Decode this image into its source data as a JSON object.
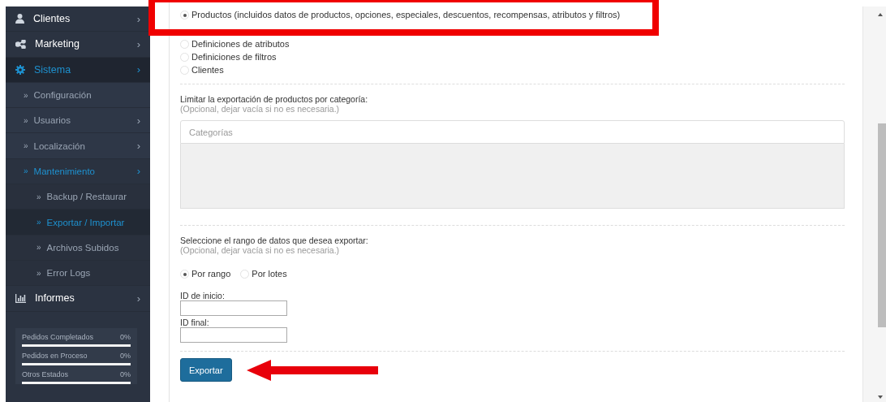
{
  "sidebar": {
    "items": [
      {
        "label": "Clientes",
        "selected": false,
        "arrow": "›"
      },
      {
        "label": "Marketing",
        "selected": false,
        "arrow": "›"
      },
      {
        "label": "Sistema",
        "selected": true,
        "arrow": "›",
        "children": [
          {
            "bullet": "»",
            "label": "Configuración",
            "selected": false
          },
          {
            "bullet": "»",
            "label": "Usuarios",
            "selected": false,
            "arrow": "›"
          },
          {
            "bullet": "»",
            "label": "Localización",
            "selected": false,
            "arrow": "›"
          },
          {
            "bullet": "»",
            "label": "Mantenimiento",
            "selected": true,
            "arrow": "›",
            "children": [
              {
                "bullet": "»",
                "label": "Backup / Restaurar",
                "selected": false
              },
              {
                "bullet": "»",
                "label": "Exportar / Importar",
                "selected": true
              },
              {
                "bullet": "»",
                "label": "Archivos Subidos",
                "selected": false
              },
              {
                "bullet": "»",
                "label": "Error Logs",
                "selected": false
              }
            ]
          }
        ]
      },
      {
        "label": "Informes",
        "selected": false,
        "arrow": "›"
      }
    ],
    "stats": [
      {
        "label": "Pedidos Completados",
        "reading": "0%",
        "level": 0
      },
      {
        "label": "Pedidos en Proceso",
        "reading": "0%",
        "level": 0
      },
      {
        "label": "Otros Estados",
        "reading": "0%",
        "level": 0
      }
    ]
  },
  "export_types": [
    {
      "label": "Productos (incluidos datos de productos, opciones, especiales, descuentos, recompensas, atributos y filtros)",
      "selected": true
    },
    {
      "label": "Definiciones de atributos",
      "selected": false
    },
    {
      "label": "Definiciones de filtros",
      "selected": false
    },
    {
      "label": "Clientes",
      "selected": false
    }
  ],
  "category_section": {
    "label": "Limitar la exportación de productos por categoría:",
    "hint": "(Opcional, dejar vacía si no es necesaria.)",
    "placeholder": "Categorías"
  },
  "range_section": {
    "label": "Seleccione el rango de datos que desea exportar:",
    "hint": "(Opcional, dejar vacía si no es necesaria.)",
    "modes": [
      {
        "label": "Por rango",
        "selected": true
      },
      {
        "label": "Por lotes",
        "selected": false
      }
    ],
    "fields": [
      {
        "label": "ID de inicio:"
      },
      {
        "label": "ID final:"
      }
    ]
  },
  "export_button": "Exportar"
}
